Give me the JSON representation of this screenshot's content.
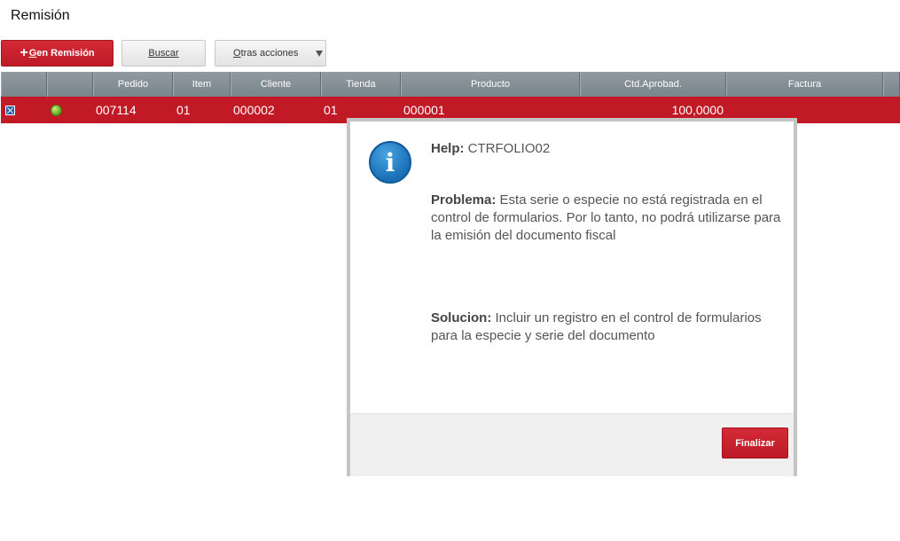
{
  "page": {
    "title": "Remisión"
  },
  "toolbar": {
    "gen_plus": "+",
    "gen_label_u": "G",
    "gen_label_rest": "en Remisión",
    "buscar_u": "B",
    "buscar_rest": "uscar",
    "otras_u": "O",
    "otras_rest": "tras acciones"
  },
  "grid": {
    "columns": [
      "",
      "",
      "Pedido",
      "Item",
      "Cliente",
      "Tienda",
      "Producto",
      "Ctd.Aprobad.",
      "Factura",
      ""
    ],
    "row": {
      "pedido": "007114",
      "item": "01",
      "cliente": "000002",
      "tienda": "01",
      "producto": "000001",
      "ctd": "100,0000",
      "factura": ""
    }
  },
  "dialog": {
    "help_label": "Help:",
    "help_code": "CTRFOLIO02",
    "problem_label": "Problema:",
    "problem_text": "Esta serie o especie no está registrada en el control de formularios. Por lo tanto, no podrá utilizarse para la emisión del documento fiscal",
    "solution_label": "Solucion:",
    "solution_text": "Incluir un registro en el control de formularios para la especie y serie del documento",
    "icon_glyph": "i",
    "finalize_label": "Finalizar"
  },
  "colors": {
    "accent": "#c11a26",
    "header": "#808b92"
  }
}
